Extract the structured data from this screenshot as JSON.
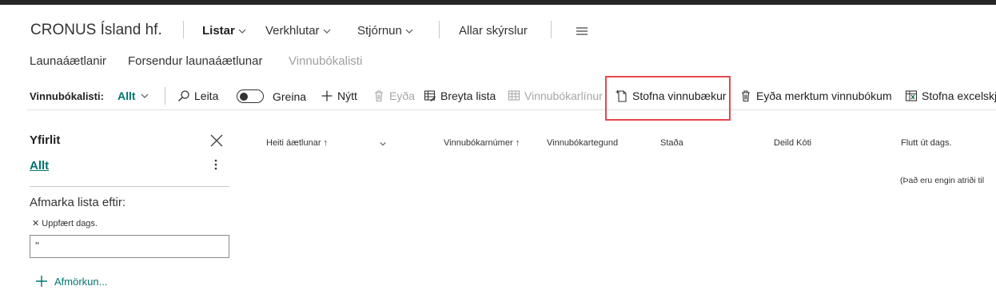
{
  "header": {
    "company": "CRONUS Ísland hf.",
    "nav": [
      {
        "label": "Listar",
        "active": true
      },
      {
        "label": "Verkhlutar"
      },
      {
        "label": "Stjórnun"
      }
    ],
    "all_reports": "Allar skýrslur",
    "menu_icon": "hamburger-icon"
  },
  "subnav": [
    "Launaáætlanir",
    "Forsendur launaáætlunar",
    "Vinnubókalisti"
  ],
  "actionbar": {
    "view_label": "Vinnubókalisti:",
    "view_value": "Allt",
    "search": "Leita",
    "analyze": "Greina",
    "new": "Nýtt",
    "delete": "Eyða",
    "edit_list": "Breyta lista",
    "lines": "Vinnubókarlínur",
    "create": "Stofna vinnubækur",
    "delete_marked": "Eyða merktum vinnubókum",
    "excel": "Stofna excelskjö"
  },
  "filter_pane": {
    "title": "Yfirlit",
    "all": "Allt",
    "filter_by": "Afmarka lista eftir:",
    "chip": "Uppfært dags.",
    "value": "''",
    "add": "Afmörkun..."
  },
  "columns": [
    "Heiti áætlunar",
    "Vinnubókarnúmer",
    "Vinnubókartegund",
    "Staða",
    "Deild Kóti",
    "Flutt út dags."
  ],
  "empty_message": "(Það eru engin atriði til",
  "colors": {
    "accent": "#00756f",
    "highlight": "#e5484d"
  }
}
